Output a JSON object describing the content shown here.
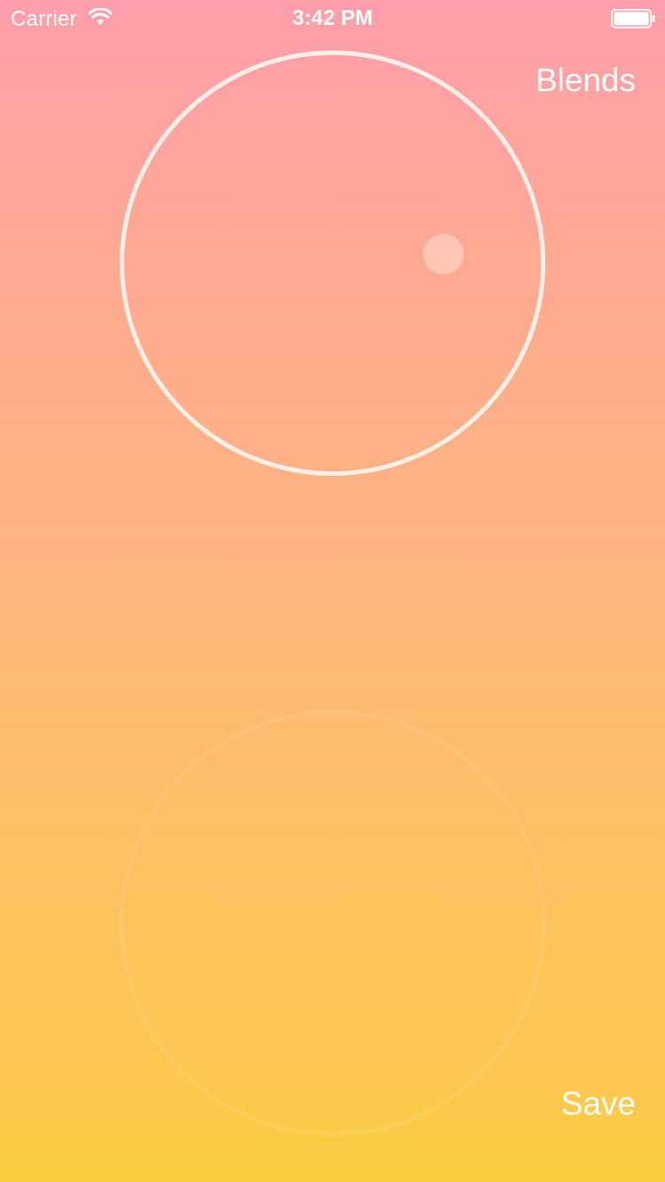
{
  "status_bar": {
    "carrier": "Carrier",
    "time": "3:42 PM",
    "icons": [
      "wifi-icon",
      "battery-icon"
    ]
  },
  "toolbar": {
    "blends_label": "Blends",
    "save_label": "Save"
  },
  "colors": {
    "gradient_top": "#ff9eab",
    "gradient_bottom": "#f5cf3d",
    "text": "#ffffff"
  }
}
